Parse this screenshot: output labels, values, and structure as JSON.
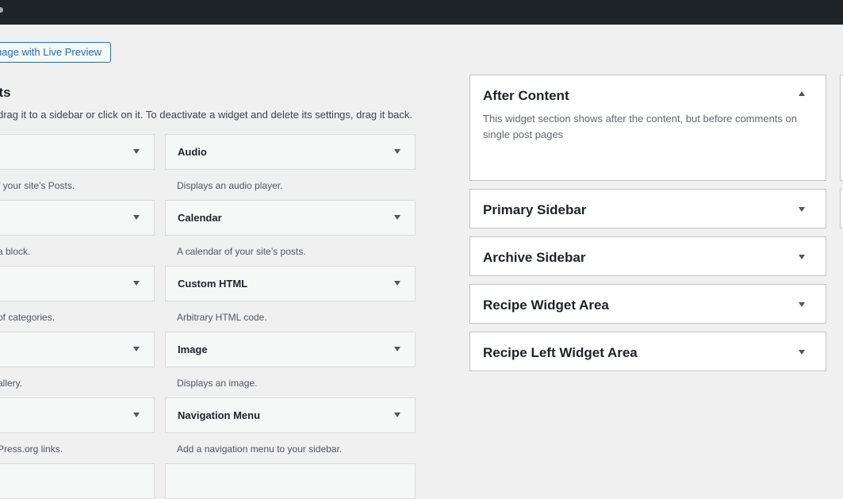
{
  "header": {
    "live_preview_button": "nage with Live Preview"
  },
  "available": {
    "heading": "ets",
    "instructions": "drag it to a sidebar or click on it. To deactivate a widget and delete its settings, drag it back."
  },
  "widgets_left": [
    {
      "title": "",
      "desc": "f your site’s Posts."
    },
    {
      "title": "",
      "desc": "a block."
    },
    {
      "title": "",
      "desc": "of categories."
    },
    {
      "title": "",
      "desc": "allery."
    },
    {
      "title": "",
      "desc": "Press.org links."
    },
    {
      "title": "",
      "desc": ""
    }
  ],
  "widgets_right": [
    {
      "title": "Audio",
      "desc": "Displays an audio player."
    },
    {
      "title": "Calendar",
      "desc": "A calendar of your site’s posts."
    },
    {
      "title": "Custom HTML",
      "desc": "Arbitrary HTML code."
    },
    {
      "title": "Image",
      "desc": "Displays an image."
    },
    {
      "title": "Navigation Menu",
      "desc": "Add a navigation menu to your sidebar."
    },
    {
      "title": "",
      "desc": ""
    }
  ],
  "widget_areas": [
    {
      "title": "After Content",
      "expanded": true,
      "description": "This widget section shows after the content, but before comments on single post pages"
    },
    {
      "title": "Primary Sidebar",
      "expanded": false
    },
    {
      "title": "Archive Sidebar",
      "expanded": false
    },
    {
      "title": "Recipe Widget Area",
      "expanded": false
    },
    {
      "title": "Recipe Left Widget Area",
      "expanded": false
    }
  ],
  "icons": {
    "toggle": "arrow-down-icon",
    "collapse": "arrow-up-icon"
  }
}
